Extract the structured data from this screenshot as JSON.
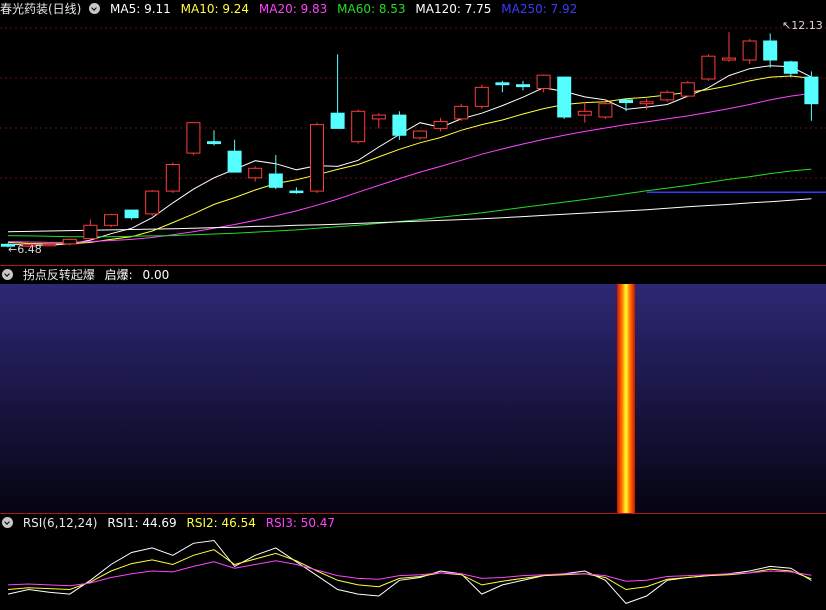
{
  "main": {
    "title": "春光药装(日线)",
    "indicators": [
      {
        "label": "MA5: ",
        "value": "9.11",
        "color": "#ffffff"
      },
      {
        "label": "MA10: ",
        "value": "9.24",
        "color": "#ffff3c"
      },
      {
        "label": "MA20: ",
        "value": "9.83",
        "color": "#ff44ff"
      },
      {
        "label": "MA60: ",
        "value": "8.53",
        "color": "#22dd22"
      },
      {
        "label": "MA120: ",
        "value": "7.75",
        "color": "#ffffff"
      },
      {
        "label": "MA250: ",
        "value": "7.92",
        "color": "#3a3aff"
      }
    ],
    "high_marker": "12.13",
    "low_marker": "6.48"
  },
  "sub1": {
    "title": "拐点反转起爆",
    "indicator_label": "启爆: ",
    "indicator_value": "0.00"
  },
  "sub2": {
    "title": "RSI(6,12,24)",
    "indicators": [
      {
        "label": "RSI1: ",
        "value": "44.69",
        "color": "#ffffff"
      },
      {
        "label": "RSI2: ",
        "value": "46.54",
        "color": "#ffff3c"
      },
      {
        "label": "RSI3: ",
        "value": "50.47",
        "color": "#ff44ff"
      }
    ]
  },
  "chart_data": {
    "type": "candlestick",
    "candles": [
      {
        "o": 6.55,
        "h": 6.58,
        "l": 6.47,
        "c": 6.5
      },
      {
        "o": 6.5,
        "h": 6.56,
        "l": 6.48,
        "c": 6.54
      },
      {
        "o": 6.52,
        "h": 6.56,
        "l": 6.5,
        "c": 6.55
      },
      {
        "o": 6.56,
        "h": 6.7,
        "l": 6.52,
        "c": 6.68
      },
      {
        "o": 6.7,
        "h": 7.2,
        "l": 6.68,
        "c": 7.05
      },
      {
        "o": 7.05,
        "h": 7.35,
        "l": 7.0,
        "c": 7.33
      },
      {
        "o": 7.45,
        "h": 7.45,
        "l": 7.2,
        "c": 7.25
      },
      {
        "o": 7.35,
        "h": 7.98,
        "l": 7.3,
        "c": 7.95
      },
      {
        "o": 7.95,
        "h": 8.7,
        "l": 7.9,
        "c": 8.65
      },
      {
        "o": 8.95,
        "h": 9.75,
        "l": 8.9,
        "c": 9.75
      },
      {
        "o": 9.25,
        "h": 9.55,
        "l": 9.15,
        "c": 9.2
      },
      {
        "o": 9.0,
        "h": 9.3,
        "l": 8.6,
        "c": 8.45
      },
      {
        "o": 8.3,
        "h": 8.6,
        "l": 8.2,
        "c": 8.55
      },
      {
        "o": 8.4,
        "h": 8.9,
        "l": 8.0,
        "c": 8.05
      },
      {
        "o": 7.95,
        "h": 8.05,
        "l": 7.88,
        "c": 7.92
      },
      {
        "o": 7.95,
        "h": 9.75,
        "l": 7.9,
        "c": 9.7
      },
      {
        "o": 10.0,
        "h": 11.55,
        "l": 9.8,
        "c": 9.6
      },
      {
        "o": 9.25,
        "h": 10.1,
        "l": 9.2,
        "c": 10.05
      },
      {
        "o": 9.85,
        "h": 10.0,
        "l": 9.6,
        "c": 9.95
      },
      {
        "o": 9.95,
        "h": 10.05,
        "l": 9.3,
        "c": 9.42
      },
      {
        "o": 9.35,
        "h": 9.55,
        "l": 9.3,
        "c": 9.53
      },
      {
        "o": 9.6,
        "h": 9.88,
        "l": 9.52,
        "c": 9.78
      },
      {
        "o": 9.85,
        "h": 10.25,
        "l": 9.8,
        "c": 10.18
      },
      {
        "o": 10.18,
        "h": 10.75,
        "l": 10.12,
        "c": 10.68
      },
      {
        "o": 10.8,
        "h": 10.85,
        "l": 10.55,
        "c": 10.75
      },
      {
        "o": 10.75,
        "h": 10.85,
        "l": 10.6,
        "c": 10.7
      },
      {
        "o": 10.65,
        "h": 11.02,
        "l": 10.55,
        "c": 11.0
      },
      {
        "o": 10.95,
        "h": 10.95,
        "l": 9.85,
        "c": 9.9
      },
      {
        "o": 9.95,
        "h": 10.3,
        "l": 9.75,
        "c": 10.05
      },
      {
        "o": 9.9,
        "h": 10.3,
        "l": 9.85,
        "c": 10.25
      },
      {
        "o": 10.35,
        "h": 10.38,
        "l": 10.05,
        "c": 10.28
      },
      {
        "o": 10.25,
        "h": 10.38,
        "l": 10.1,
        "c": 10.3
      },
      {
        "o": 10.35,
        "h": 10.6,
        "l": 10.3,
        "c": 10.55
      },
      {
        "o": 10.45,
        "h": 10.85,
        "l": 10.42,
        "c": 10.8
      },
      {
        "o": 10.9,
        "h": 11.55,
        "l": 10.85,
        "c": 11.5
      },
      {
        "o": 11.4,
        "h": 12.13,
        "l": 11.35,
        "c": 11.45
      },
      {
        "o": 11.4,
        "h": 11.95,
        "l": 11.3,
        "c": 11.9
      },
      {
        "o": 11.9,
        "h": 12.1,
        "l": 11.2,
        "c": 11.4
      },
      {
        "o": 11.35,
        "h": 11.38,
        "l": 10.95,
        "c": 11.05
      },
      {
        "o": 10.95,
        "h": 11.1,
        "l": 9.8,
        "c": 10.25
      }
    ],
    "ma": [
      {
        "name": "MA5",
        "color": "#ffffff",
        "values": [
          6.55,
          6.53,
          6.53,
          6.56,
          6.66,
          6.83,
          6.97,
          7.25,
          7.64,
          8.0,
          8.3,
          8.52,
          8.75,
          8.67,
          8.51,
          8.62,
          8.6,
          8.76,
          9.11,
          9.44,
          9.75,
          9.63,
          9.85,
          10.0,
          10.2,
          10.42,
          10.67,
          10.57,
          10.43,
          10.35,
          10.1,
          10.16,
          10.23,
          10.45,
          10.67,
          10.99,
          11.17,
          11.25,
          11.22,
          10.95
        ]
      },
      {
        "name": "MA10",
        "color": "#ffff3c",
        "values": [
          6.6,
          6.57,
          6.56,
          6.56,
          6.6,
          6.68,
          6.75,
          6.9,
          7.12,
          7.35,
          7.6,
          7.78,
          7.98,
          8.15,
          8.25,
          8.38,
          8.52,
          8.65,
          8.85,
          9.05,
          9.22,
          9.36,
          9.55,
          9.7,
          9.82,
          9.98,
          10.12,
          10.23,
          10.28,
          10.3,
          10.38,
          10.42,
          10.48,
          10.55,
          10.62,
          10.72,
          10.85,
          10.95,
          10.98,
          10.92
        ]
      },
      {
        "name": "MA20",
        "color": "#ff44ff",
        "values": [
          6.62,
          6.61,
          6.6,
          6.6,
          6.62,
          6.65,
          6.68,
          6.73,
          6.8,
          6.88,
          6.97,
          7.07,
          7.18,
          7.3,
          7.43,
          7.58,
          7.74,
          7.92,
          8.1,
          8.28,
          8.45,
          8.6,
          8.76,
          8.92,
          9.06,
          9.19,
          9.31,
          9.42,
          9.52,
          9.61,
          9.7,
          9.77,
          9.85,
          9.93,
          10.02,
          10.12,
          10.23,
          10.35,
          10.45,
          10.52
        ]
      },
      {
        "name": "MA60",
        "color": "#22dd22",
        "values": [
          6.78,
          6.77,
          6.76,
          6.75,
          6.75,
          6.75,
          6.76,
          6.77,
          6.78,
          6.8,
          6.82,
          6.84,
          6.87,
          6.9,
          6.93,
          6.97,
          7.01,
          7.05,
          7.1,
          7.15,
          7.2,
          7.26,
          7.32,
          7.38,
          7.45,
          7.52,
          7.59,
          7.66,
          7.73,
          7.8,
          7.88,
          7.96,
          8.03,
          8.1,
          8.18,
          8.26,
          8.33,
          8.41,
          8.48,
          8.53
        ]
      },
      {
        "name": "MA120",
        "color": "#ffffff",
        "values": [
          6.88,
          6.89,
          6.9,
          6.91,
          6.92,
          6.93,
          6.94,
          6.95,
          6.96,
          6.97,
          6.99,
          7.0,
          7.02,
          7.03,
          7.05,
          7.06,
          7.08,
          7.1,
          7.12,
          7.14,
          7.16,
          7.18,
          7.2,
          7.22,
          7.25,
          7.28,
          7.31,
          7.34,
          7.37,
          7.4,
          7.43,
          7.46,
          7.5,
          7.54,
          7.57,
          7.6,
          7.64,
          7.67,
          7.71,
          7.75
        ]
      }
    ],
    "ma250_segment": {
      "name": "MA250",
      "color": "#3a3aff",
      "from_index": 31,
      "to_index": 39,
      "value": 7.92
    },
    "signal": {
      "name": "启爆",
      "index": 30
    },
    "rsi": {
      "series": [
        {
          "name": "RSI1",
          "color": "#ffffff",
          "values": [
            30,
            35,
            32,
            30,
            45,
            62,
            75,
            80,
            72,
            85,
            88,
            60,
            72,
            80,
            65,
            50,
            35,
            30,
            28,
            45,
            48,
            55,
            52,
            30,
            40,
            45,
            50,
            52,
            55,
            45,
            20,
            28,
            45,
            48,
            50,
            52,
            55,
            60,
            58,
            44.69
          ]
        },
        {
          "name": "RSI2",
          "color": "#ffff3c",
          "values": [
            35,
            37,
            36,
            35,
            43,
            55,
            63,
            67,
            62,
            72,
            78,
            62,
            68,
            74,
            66,
            55,
            45,
            40,
            38,
            47,
            49,
            53,
            51,
            40,
            44,
            47,
            50,
            51,
            52,
            48,
            35,
            38,
            46,
            48,
            50,
            51,
            53,
            57,
            55,
            46.54
          ]
        },
        {
          "name": "RSI3",
          "color": "#ff44ff",
          "values": [
            40,
            41,
            40,
            39,
            42,
            48,
            52,
            55,
            54,
            60,
            65,
            58,
            62,
            66,
            62,
            56,
            50,
            47,
            46,
            50,
            51,
            53,
            52,
            47,
            48,
            50,
            51,
            52,
            52,
            50,
            44,
            45,
            49,
            50,
            51,
            52,
            53,
            55,
            54,
            50.47
          ]
        }
      ]
    }
  }
}
